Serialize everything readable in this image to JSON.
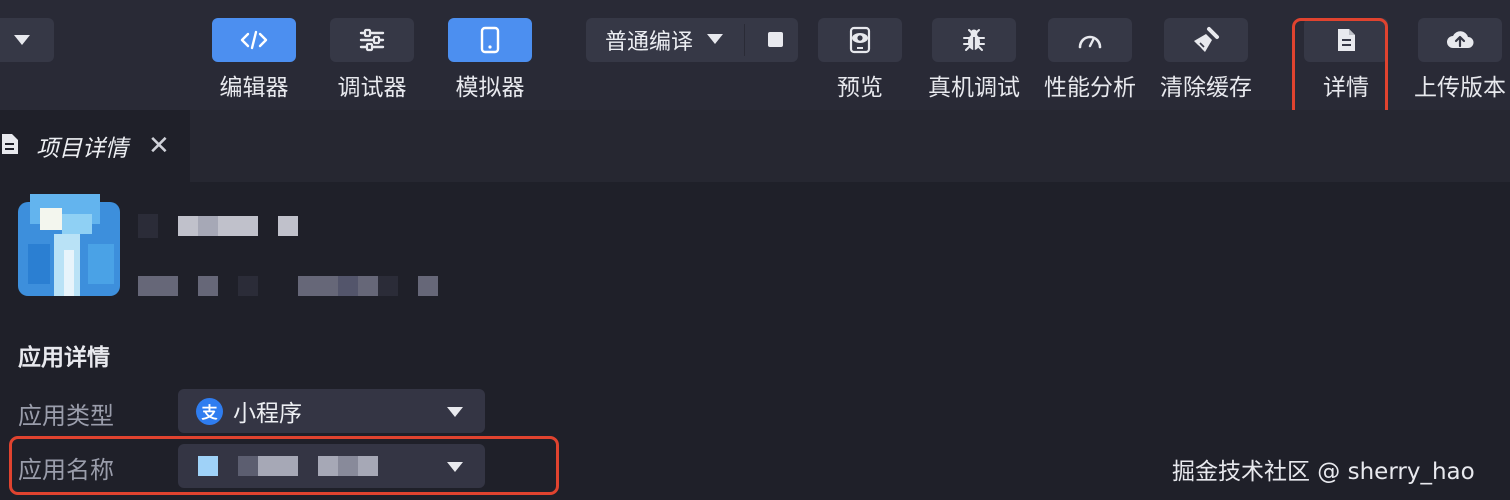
{
  "toolbar": {
    "editor_label": "编辑器",
    "debugger_label": "调试器",
    "simulator_label": "模拟器",
    "compile_mode": "普通编译",
    "preview_label": "预览",
    "device_debug_label": "真机调试",
    "performance_label": "性能分析",
    "clear_cache_label": "清除缓存",
    "details_label": "详情",
    "upload_label": "上传版本",
    "highlight_color": "#e0432f",
    "active_color": "#4c8ff0"
  },
  "tabs": [
    {
      "label": "项目详情",
      "icon": "document-icon"
    }
  ],
  "content": {
    "section_title": "应用详情",
    "app_type_label": "应用类型",
    "app_type_value": "小程序",
    "app_type_icon": "支",
    "app_name_label": "应用名称"
  },
  "watermark": "掘金技术社区 @ sherry_hao"
}
